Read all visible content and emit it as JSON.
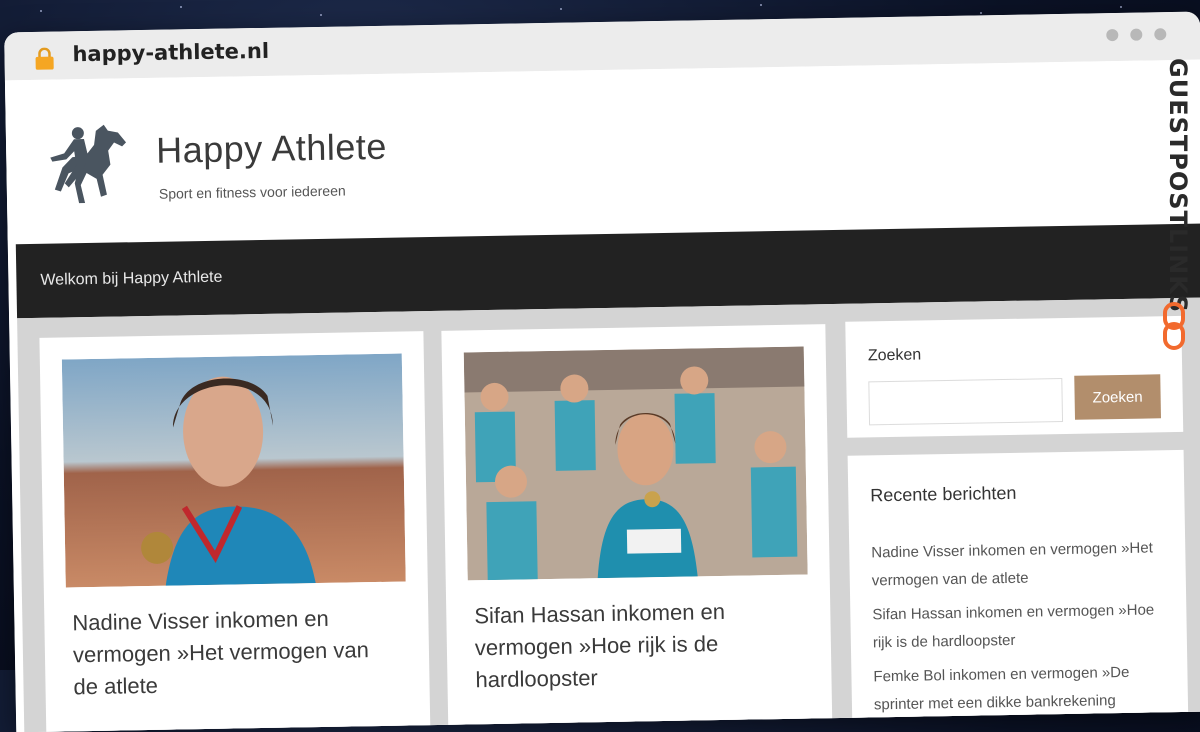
{
  "browser": {
    "url": "happy-athlete.nl"
  },
  "site": {
    "title": "Happy Athlete",
    "tagline": "Sport en fitness voor iedereen"
  },
  "nav": {
    "items": [
      {
        "label": "Welkom bij Happy Athlete"
      }
    ]
  },
  "posts": [
    {
      "title": "Nadine Visser inkomen en vermogen »Het vermogen van de atlete"
    },
    {
      "title": "Sifan Hassan inkomen en vermogen »Hoe rijk is de hardloopster"
    }
  ],
  "search_widget": {
    "label": "Zoeken",
    "placeholder": "",
    "button_label": "Zoeken"
  },
  "recent_widget": {
    "title": "Recente berichten",
    "items": [
      "Nadine Visser inkomen en vermogen »Het vermogen van de atlete",
      "Sifan Hassan inkomen en vermogen »Hoe rijk is de hardloopster",
      "Femke Bol inkomen en vermogen »De sprinter met een dikke bankrekening"
    ]
  },
  "watermark": {
    "text": "GUESTPOSTLINKS"
  },
  "colors": {
    "nav_bg": "#222222",
    "search_button": "#b28e6c",
    "content_bg": "#d4d4d4",
    "watermark_accent": "#f26a2e"
  }
}
